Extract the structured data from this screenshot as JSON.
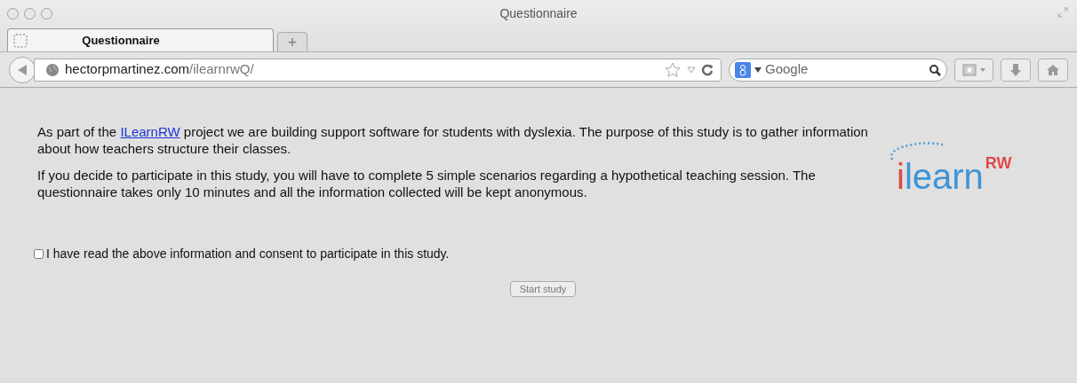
{
  "window": {
    "title": "Questionnaire"
  },
  "tabs": [
    {
      "label": "Questionnaire",
      "selected": true
    }
  ],
  "new_tab": "+",
  "address_bar": {
    "host": "hectorpmartinez.com",
    "path": "/ilearnrwQ/"
  },
  "search": {
    "placeholder": "Google"
  },
  "content": {
    "intro": {
      "before": "As part of the ",
      "link": "ILearnRW",
      "after": " project we are building support software for students with dyslexia. The purpose of this study is to gather information about how teachers structure their classes."
    },
    "paragraph": "If you decide to participate in this study, you will have to complete 5 simple scenarios regarding a hypothetical teaching session. The questionnaire takes only 10 minutes and all the information collected will be kept anonymous.",
    "logo": {
      "first": "i",
      "rest": "learn",
      "superscript": "RW"
    },
    "consent": {
      "label": "I have read the above information and consent to participate in this study.",
      "checked": false
    },
    "start_button": {
      "label": "Start study",
      "disabled": true
    }
  }
}
